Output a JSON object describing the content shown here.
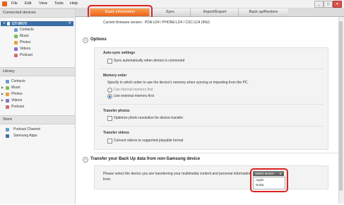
{
  "menu": {
    "items": [
      "File",
      "Edit",
      "View",
      "Tools",
      "Help"
    ]
  },
  "window": {
    "minimize": "_",
    "maximize": "□",
    "close": "✕"
  },
  "sidebar": {
    "connected_title": "Connected devices",
    "device_name": "GT-I9070",
    "device_items": [
      "Contacts",
      "Music",
      "Photos",
      "Videos",
      "Podcast"
    ],
    "library_title": "Library",
    "library_items": [
      "Contacts",
      "Music",
      "Photos",
      "Videos",
      "Podcast"
    ],
    "store_title": "Store",
    "store_items": [
      "Podcast Channel",
      "Samsung Apps"
    ]
  },
  "tabs": [
    "Basic information",
    "Sync",
    "Import/Export",
    "Back up/Restore"
  ],
  "firmware_text": "Current firmware version : PDA:LD4 / PHONE:LD4 / CSC:LD4 (INU)",
  "options": {
    "title": "Options",
    "auto_sync": {
      "title": "Auto-sync settings",
      "label": "Sync automatically when device is connected"
    },
    "memory": {
      "title": "Memory order",
      "desc": "Specify in which order to use the device's memory when syncing or importing from the PC.",
      "opt1": "Use internal memory first",
      "opt2": "Use external memory first"
    },
    "photos": {
      "title": "Transfer photos",
      "label": "Optimize photo resolution for device transfer"
    },
    "videos": {
      "title": "Transfer videos",
      "label": "Convert videos to supported playable format"
    }
  },
  "transfer": {
    "title": "Transfer your Back Up data from non-Samsung device",
    "desc": "Please select the device you are transferring your multimedia content and personal information from.",
    "select_value": "Select device",
    "options": [
      "Apple",
      "Nokia"
    ]
  },
  "colors": {
    "accent": "#e8621e",
    "highlight": "#d22222",
    "device_row": "#3a6ea5"
  }
}
